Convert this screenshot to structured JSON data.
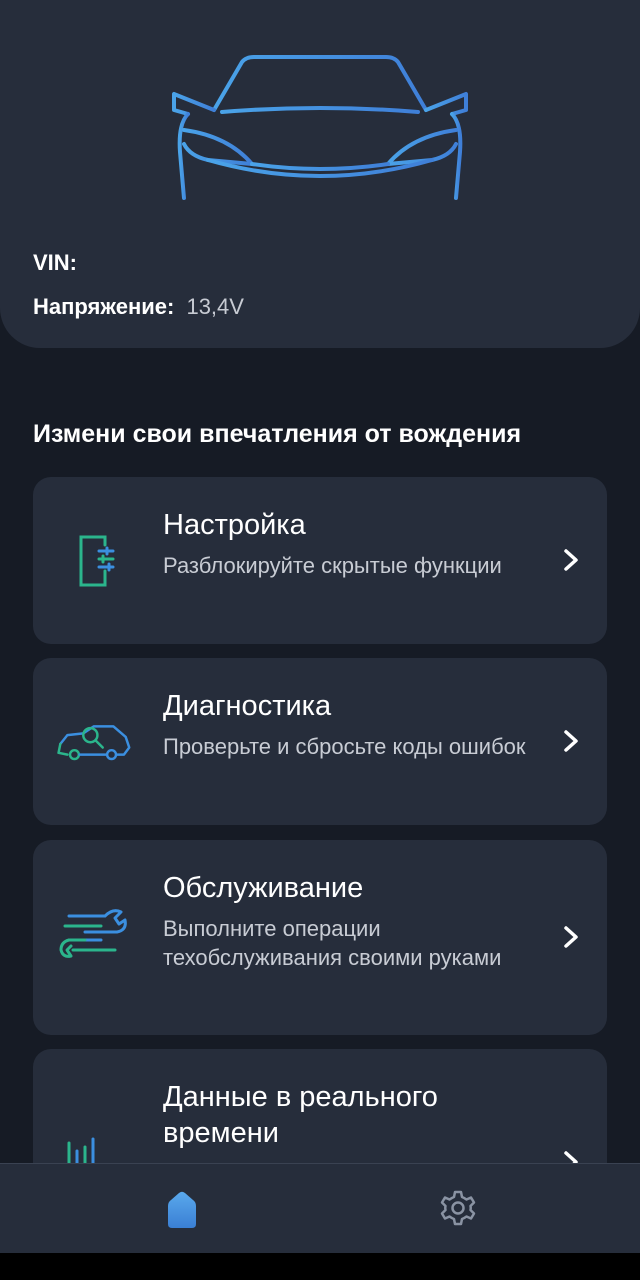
{
  "header": {
    "vin_label": "VIN:",
    "vin_value": "",
    "voltage_label": "Напряжение:",
    "voltage_value": "13,4V"
  },
  "section": {
    "title": "Измени свои впечатления от вождения"
  },
  "menu": {
    "items": [
      {
        "title": "Настройка",
        "subtitle": "Разблокируйте скрытые функции",
        "icon": "settings-panel-icon"
      },
      {
        "title": "Диагностика",
        "subtitle": "Проверьте и сбросьте коды ошибок",
        "icon": "car-diagnostics-icon"
      },
      {
        "title": "Обслуживание",
        "subtitle": "Выполните операции техобслуживания своими руками",
        "icon": "wrench-icon"
      },
      {
        "title": "Данные в реального времени",
        "subtitle": "",
        "icon": "bar-chart-icon"
      }
    ]
  },
  "nav": {
    "items": [
      {
        "icon": "home-icon",
        "active": true
      },
      {
        "icon": "gear-icon",
        "active": false
      }
    ]
  },
  "colors": {
    "background": "#161b25",
    "card": "#262d3b",
    "accent_blue": "#3b8fe0",
    "accent_teal": "#2bb58c"
  }
}
